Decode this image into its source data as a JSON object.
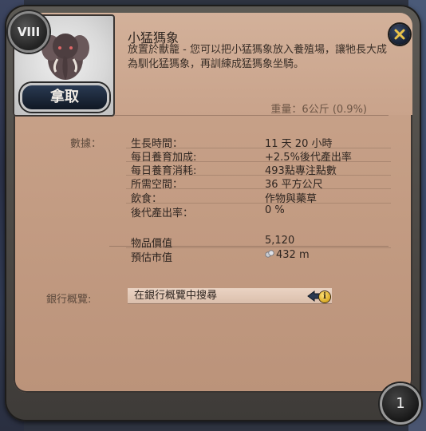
{
  "item": {
    "tier": "VIII",
    "name": "小猛獁象",
    "description": "放置於獸籠 - 您可以把小猛獁象放入養殖場，讓牠長大成為馴化猛獁象，再訓練成猛獁象坐騎。",
    "weight_label": "重量：",
    "weight_value": "6公斤 (0.9%)",
    "take_label": "拿取",
    "stack_count": "1"
  },
  "stats": {
    "section_label": "數據：",
    "rows": [
      {
        "label": "生長時間：",
        "value": "11 天 20 小時"
      },
      {
        "label": "每日養育加成:",
        "value": "+2.5%後代產出率"
      },
      {
        "label": "每日養育消耗:",
        "value": "493點專注點數"
      },
      {
        "label": "所需空間：",
        "value": "36 平方公尺"
      },
      {
        "label": "飲食：",
        "value": "作物與藥草"
      },
      {
        "label": "後代產出率：",
        "value": "0 %"
      }
    ],
    "item_value_label": "物品價值",
    "item_value": "5,120",
    "market_label": "預估市值",
    "market_value": "432 m"
  },
  "bank": {
    "label": "銀行概覽:",
    "search_text": "在銀行概覽中搜尋"
  },
  "icons": {
    "close": "close-icon",
    "info": "info-icon",
    "back": "back-arrow-icon",
    "coin": "silver-coin-icon",
    "portrait": "baby-mammoth-icon"
  },
  "colors": {
    "panel": "#c9a28a",
    "header": "#d3b19a",
    "frame": "#4a4744",
    "text": "#2e2520",
    "accent_gold": "#d2a018"
  }
}
